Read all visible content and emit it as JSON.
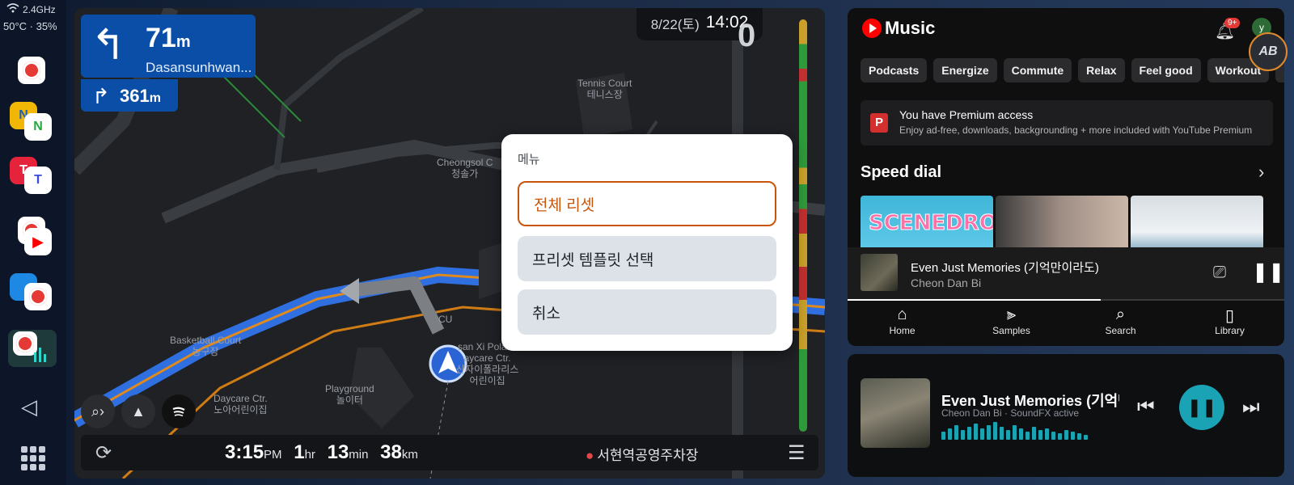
{
  "status": {
    "wifi_label": "2.4GHz",
    "temp_humidity": "50°C · 35%"
  },
  "dock": {
    "apps": [
      {
        "name": "youtube-music"
      },
      {
        "name": "maps-naver"
      },
      {
        "name": "tmap"
      },
      {
        "name": "youtube"
      },
      {
        "name": "youtube-music-2"
      },
      {
        "name": "equalizer"
      }
    ]
  },
  "navigation": {
    "turn_distance": "71",
    "turn_unit": "m",
    "turn_road": "Dasansunhwan...",
    "next_turn_distance": "361",
    "next_turn_unit": "m",
    "date": "8/22(토)",
    "time": "14:02",
    "speed": "0",
    "pois": [
      "Tennis Court",
      "테니스장",
      "Cheongsol C",
      "청솔가",
      "Basketball Court",
      "농구장",
      "Daycare Ctr.",
      "노아어린이집",
      "Playground",
      "놀이터",
      "CU",
      "san Xi Polaris",
      "aycare Ctr.",
      "산자이폴라리스",
      "어린이집"
    ],
    "eta": {
      "hour": "3:15",
      "ampm": "PM",
      "dur_h": "1",
      "dur_h_unit": "hr",
      "dur_m": "13",
      "dur_m_unit": "min",
      "dist": "38",
      "dist_unit": "km"
    },
    "destination": "서현역공영주차장"
  },
  "dialog": {
    "title": "메뉴",
    "buttons": [
      "전체 리셋",
      "프리셋 템플릿 선택",
      "취소"
    ]
  },
  "music": {
    "app_name": "Music",
    "notif_count": "9+",
    "user_initial": "y",
    "chips": [
      "Podcasts",
      "Energize",
      "Commute",
      "Relax",
      "Feel good",
      "Workout",
      "Fo"
    ],
    "premium_title": "You have Premium access",
    "premium_desc": "Enjoy ad-free, downloads, backgrounding + more included with YouTube Premium",
    "speed_dial": "Speed dial",
    "mini_title": "Even Just Memories (기억만이라도)",
    "mini_artist": "Cheon Dan Bi",
    "progress": 0.58,
    "tabs": [
      "Home",
      "Samples",
      "Search",
      "Library"
    ]
  },
  "now_playing": {
    "title": "Even Just Memories (기억만",
    "subtitle": "Cheon Dan Bi · SoundFX active"
  },
  "overlay_badge": "AB",
  "colors": {
    "accent": "#c7550a",
    "nav_blue": "#0a4ea8",
    "play_teal": "#19a3b5"
  }
}
